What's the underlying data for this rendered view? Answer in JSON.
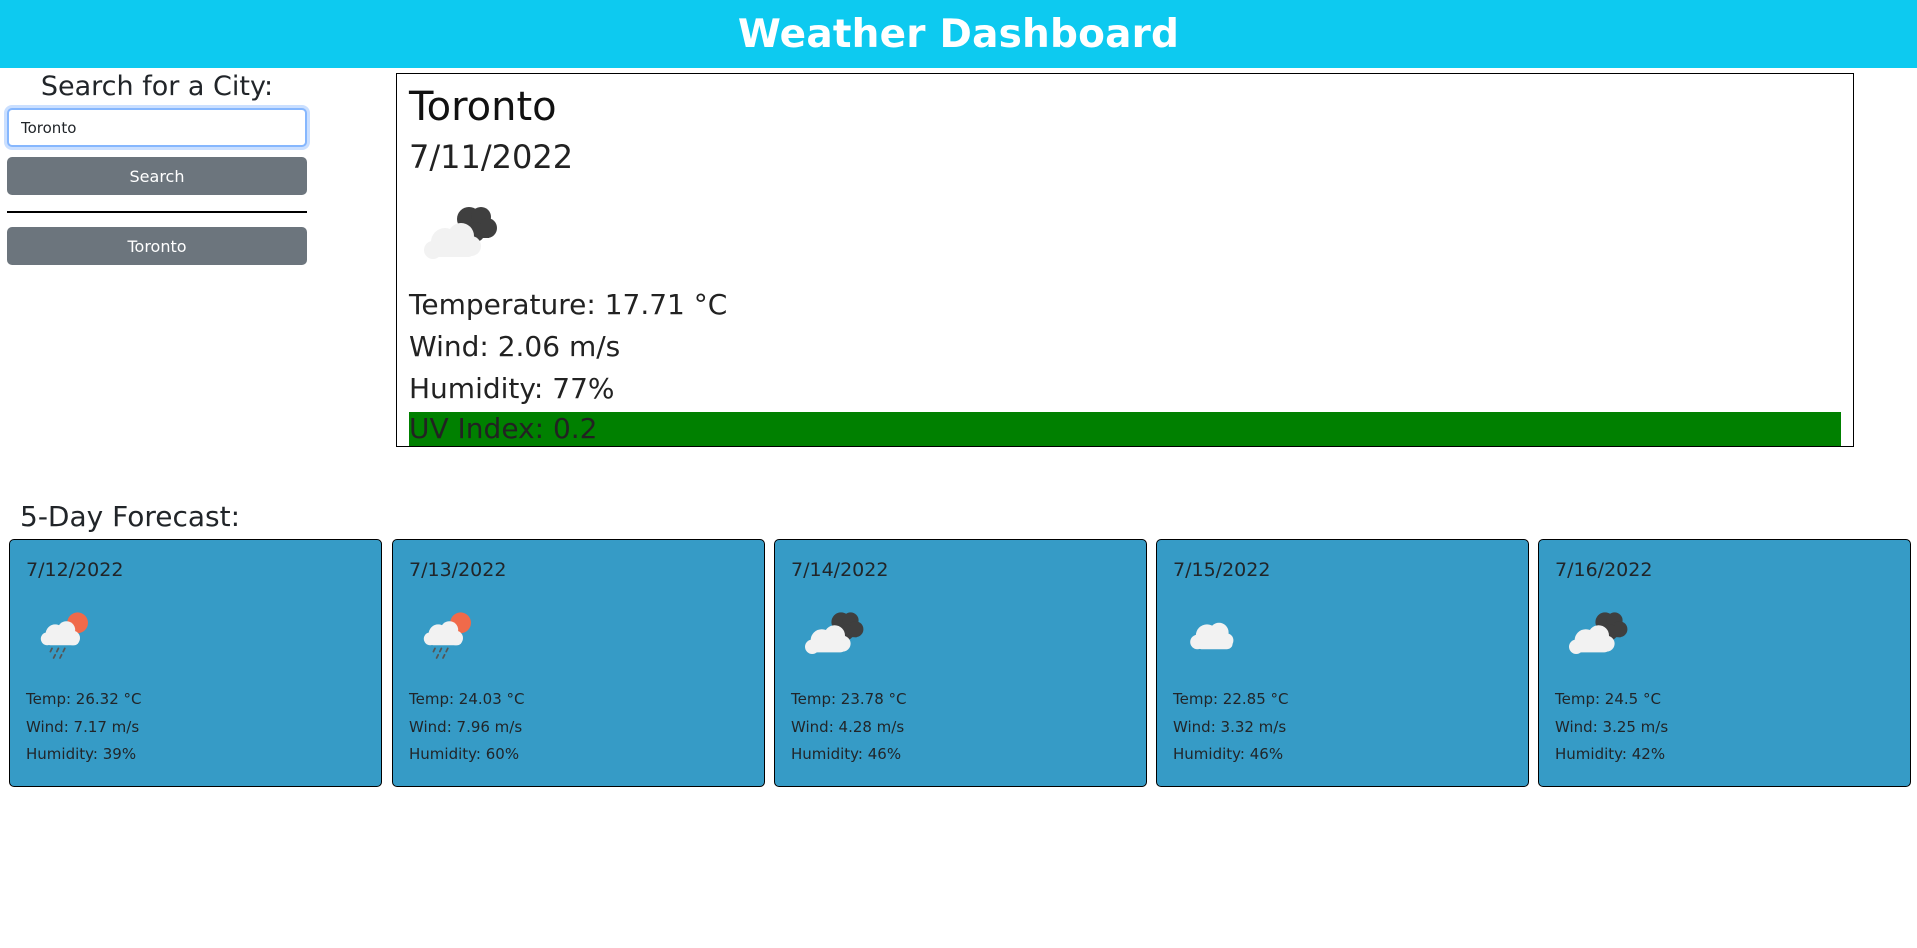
{
  "header": {
    "title": "Weather Dashboard"
  },
  "search": {
    "heading": "Search for a City:",
    "input_value": "Toronto",
    "button_label": "Search"
  },
  "history": [
    {
      "label": "Toronto"
    }
  ],
  "current": {
    "city": "Toronto",
    "date": "7/11/2022",
    "icon": "broken-clouds-icon",
    "temperature": "Temperature: 17.71 °C",
    "wind": "Wind: 2.06 m/s",
    "humidity": "Humidity: 77%",
    "uv": "UV Index: 0.2",
    "uv_color": "#008000"
  },
  "forecast": {
    "heading": "5-Day Forecast:",
    "card_color": "#369bc6",
    "days": [
      {
        "date": "7/12/2022",
        "icon": "rain-sun-icon",
        "temp": "Temp: 26.32 °C",
        "wind": "Wind: 7.17 m/s",
        "humidity": "Humidity: 39%"
      },
      {
        "date": "7/13/2022",
        "icon": "rain-sun-icon",
        "temp": "Temp: 24.03 °C",
        "wind": "Wind: 7.96 m/s",
        "humidity": "Humidity: 60%"
      },
      {
        "date": "7/14/2022",
        "icon": "broken-clouds-icon",
        "temp": "Temp: 23.78 °C",
        "wind": "Wind: 4.28 m/s",
        "humidity": "Humidity: 46%"
      },
      {
        "date": "7/15/2022",
        "icon": "cloud-icon",
        "temp": "Temp: 22.85 °C",
        "wind": "Wind: 3.32 m/s",
        "humidity": "Humidity: 46%"
      },
      {
        "date": "7/16/2022",
        "icon": "broken-clouds-icon",
        "temp": "Temp: 24.5 °C",
        "wind": "Wind: 3.25 m/s",
        "humidity": "Humidity: 42%"
      }
    ]
  },
  "colors": {
    "header_bg": "#0dcaf0",
    "button_bg": "#6c757d"
  }
}
